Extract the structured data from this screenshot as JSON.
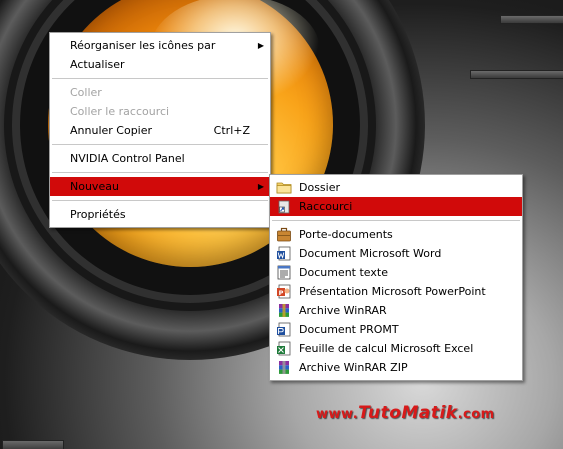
{
  "context_menu": {
    "items": [
      {
        "label": "Réorganiser les icônes par"
      },
      {
        "label": "Actualiser"
      },
      {
        "label": "Coller"
      },
      {
        "label": "Coller le raccourci"
      },
      {
        "label": "Annuler Copier",
        "shortcut": "Ctrl+Z"
      },
      {
        "label": "NVIDIA Control Panel"
      },
      {
        "label": "Nouveau"
      },
      {
        "label": "Propriétés"
      }
    ]
  },
  "new_submenu": {
    "items": [
      {
        "label": "Dossier",
        "icon": "folder-icon"
      },
      {
        "label": "Raccourci",
        "icon": "shortcut-icon"
      },
      {
        "label": "Porte-documents",
        "icon": "briefcase-icon"
      },
      {
        "label": "Document Microsoft Word",
        "icon": "word-document-icon"
      },
      {
        "label": "Document texte",
        "icon": "text-document-icon"
      },
      {
        "label": "Présentation Microsoft PowerPoint",
        "icon": "powerpoint-icon"
      },
      {
        "label": "Archive WinRAR",
        "icon": "winrar-archive-icon"
      },
      {
        "label": "Document PROMT",
        "icon": "promt-document-icon"
      },
      {
        "label": "Feuille de calcul Microsoft Excel",
        "icon": "excel-icon"
      },
      {
        "label": "Archive WinRAR ZIP",
        "icon": "winrar-zip-icon"
      }
    ]
  },
  "watermark": {
    "prefix": "www.",
    "brand": "TutoMatik",
    "suffix": ".com"
  },
  "colors": {
    "highlight": "#d10a0a",
    "watermark": "#d71a1a",
    "disabled_text": "#a3a3a3"
  }
}
